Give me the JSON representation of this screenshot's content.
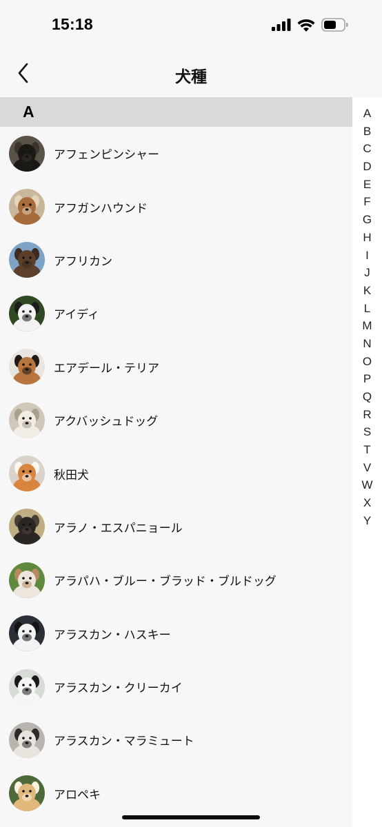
{
  "status_bar": {
    "time": "15:18"
  },
  "nav": {
    "title": "犬種",
    "back_icon": "chevron-left-icon"
  },
  "section": {
    "letter": "A"
  },
  "breeds": [
    {
      "name": "アフェンピンシャー",
      "bg": "#5a5348",
      "fur": "#1a1916",
      "accent": "#3a352f"
    },
    {
      "name": "アフガンハウンド",
      "bg": "#c9b79c",
      "fur": "#a86b3c",
      "accent": "#e3d3b8"
    },
    {
      "name": "アフリカン",
      "bg": "#7fa3c7",
      "fur": "#5b3f2b",
      "accent": "#3b2a1f"
    },
    {
      "name": "アイディ",
      "bg": "#2f4a22",
      "fur": "#f2f2f0",
      "accent": "#1c1c1c"
    },
    {
      "name": "エアデール・テリア",
      "bg": "#e8e5e0",
      "fur": "#b8763e",
      "accent": "#1f1a16"
    },
    {
      "name": "アクバッシュドッグ",
      "bg": "#cfc8b8",
      "fur": "#f1ede4",
      "accent": "#a89f8c"
    },
    {
      "name": "秋田犬",
      "bg": "#d9d3cc",
      "fur": "#d9843f",
      "accent": "#faf6f0"
    },
    {
      "name": "アラノ・エスパニョール",
      "bg": "#bfae83",
      "fur": "#2a2623",
      "accent": "#4a4038"
    },
    {
      "name": "アラパハ・ブルー・ブラッド・ブルドッグ",
      "bg": "#5f8a3d",
      "fur": "#ece6dc",
      "accent": "#b98a60"
    },
    {
      "name": "アラスカン・ハスキー",
      "bg": "#2b2f36",
      "fur": "#f3f3f3",
      "accent": "#151515"
    },
    {
      "name": "アラスカン・クリーカイ",
      "bg": "#d6dbd5",
      "fur": "#f5f5f5",
      "accent": "#1a1a1a"
    },
    {
      "name": "アラスカン・マラミュート",
      "bg": "#b9b4ad",
      "fur": "#e9e5de",
      "accent": "#2e2a27"
    },
    {
      "name": "アロペキ",
      "bg": "#4f6a3a",
      "fur": "#e2b77c",
      "accent": "#fbf2e2"
    }
  ],
  "index_letters": [
    "A",
    "B",
    "C",
    "D",
    "E",
    "F",
    "G",
    "H",
    "I",
    "J",
    "K",
    "L",
    "M",
    "N",
    "O",
    "P",
    "Q",
    "R",
    "S",
    "T",
    "V",
    "W",
    "X",
    "Y"
  ]
}
